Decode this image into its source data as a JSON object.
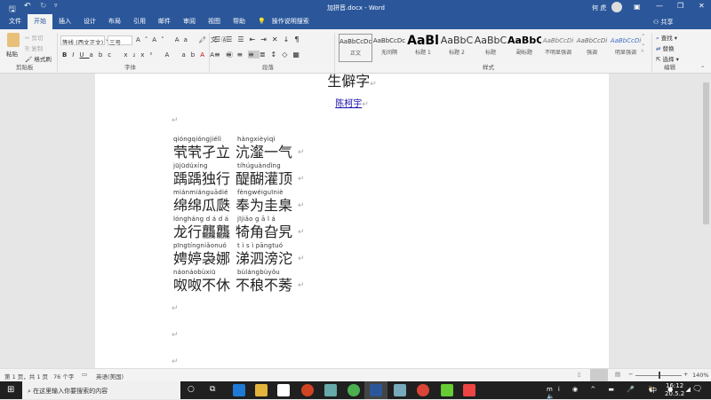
{
  "window": {
    "title": "加拼音.docx - Word",
    "user": "何 虎",
    "share": "共享"
  },
  "tabs": [
    "文件",
    "开始",
    "插入",
    "设计",
    "布局",
    "引用",
    "邮件",
    "审阅",
    "视图",
    "帮助"
  ],
  "tell_me": "操作说明搜索",
  "ribbon": {
    "clipboard": {
      "paste": "粘贴",
      "cut": "剪切",
      "copy": "复制",
      "format_painter": "格式刷",
      "label": "剪贴板"
    },
    "font": {
      "name": "等线 (西文正文)",
      "size": "三号",
      "label": "字体"
    },
    "paragraph": {
      "label": "段落"
    },
    "styles": {
      "label": "样式",
      "items": [
        {
          "preview": "AaBbCcDc",
          "name": "正文"
        },
        {
          "preview": "AaBbCcDc",
          "name": "无间隔"
        },
        {
          "preview": "AaBl",
          "name": "标题 1"
        },
        {
          "preview": "AaBbC",
          "name": "标题 2"
        },
        {
          "preview": "AaBbC",
          "name": "标题"
        },
        {
          "preview": "AaBbC",
          "name": "副标题"
        },
        {
          "preview": "AaBbCcDi",
          "name": "不明显强调"
        },
        {
          "preview": "AaBbCcDi",
          "name": "强调"
        },
        {
          "preview": "AaBbCcDi",
          "name": "明显强调"
        }
      ]
    },
    "editing": {
      "find": "查找",
      "replace": "替换",
      "select": "选择",
      "label": "编辑"
    }
  },
  "document": {
    "title": "生僻字",
    "author": "陈柯宇",
    "rows": [
      {
        "pinyin": [
          "qióngqióngjiélì",
          "hàngxièyìqì"
        ],
        "chars": [
          "茕茕孑立",
          "沆瀣一气"
        ]
      },
      {
        "pinyin": [
          "jūjūdúxíng",
          "tíhúguàndǐng"
        ],
        "chars": [
          "踽踽独行",
          "醍醐灌顶"
        ]
      },
      {
        "pinyin": [
          "miánmiánguādié",
          "fèngwéiguīniè"
        ],
        "chars": [
          "绵绵瓜瓞",
          "奉为圭臬"
        ]
      },
      {
        "pinyin": [
          "lóngháng d á d á",
          "jījiǎo g ā l á"
        ],
        "chars": [
          "龙行龘龘",
          "犄角旮旯"
        ]
      },
      {
        "pinyin": [
          "pīngtíngniǎonuó",
          "t ì s ì pāngtuó"
        ],
        "chars": [
          "娉婷袅娜",
          "涕泗滂沱"
        ]
      },
      {
        "pinyin": [
          "náonáobùxiū",
          "bùlángbùyǒu"
        ],
        "chars": [
          "呶呶不休",
          "不稂不莠"
        ]
      }
    ]
  },
  "status": {
    "page": "第 1 页，共 1 页",
    "words": "76 个字",
    "language": "英语(美国)",
    "zoom": "140%",
    "zoom_level": 140
  },
  "taskbar": {
    "search_placeholder": "在这里输入你要搜索的内容",
    "time": "16:12",
    "date": "20.5.2",
    "ime": "中",
    "notifications": "2"
  },
  "colors": {
    "accent": "#2b579a",
    "link": "#1a0dab"
  }
}
